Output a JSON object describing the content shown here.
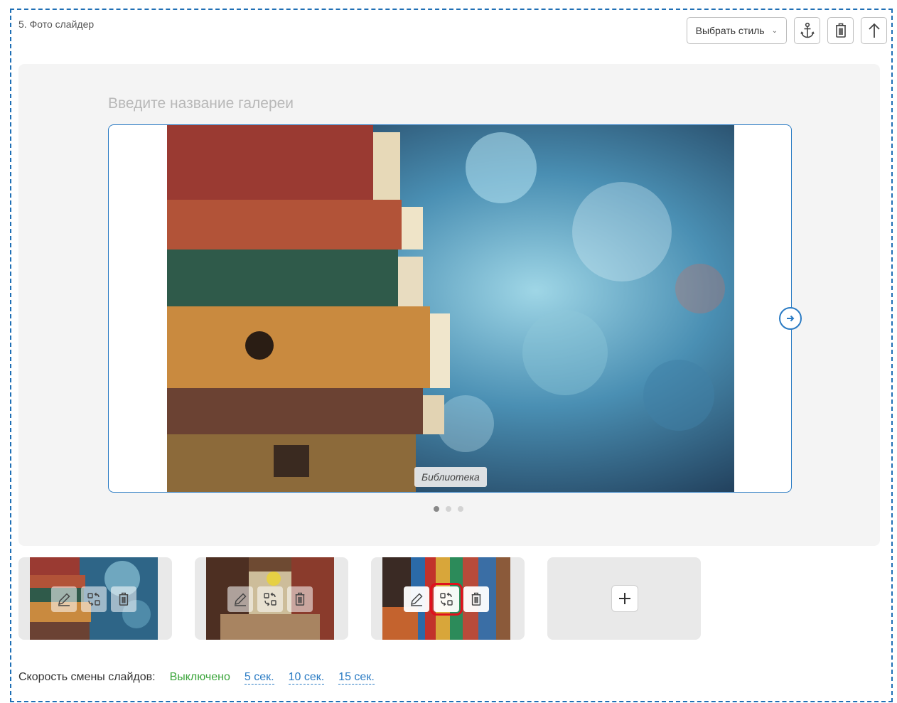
{
  "block": {
    "title": "5. Фото слайдер",
    "style_button": {
      "label": "Выбрать стиль",
      "chevron": "chevron-down-icon"
    },
    "tools": [
      {
        "name": "anchor-icon"
      },
      {
        "name": "trash-icon"
      },
      {
        "name": "arrow-up-icon"
      }
    ]
  },
  "gallery": {
    "title_placeholder": "Введите название галереи",
    "slide_caption": "Библиотека",
    "slide_count": 3,
    "active_slide": 1
  },
  "thumbnails": [
    {
      "subject": "stack of old books, bokeh background",
      "actions": [
        "pencil-icon",
        "swap-icon",
        "trash-icon"
      ]
    },
    {
      "subject": "library reading area",
      "actions": [
        "pencil-icon",
        "swap-icon",
        "trash-icon"
      ]
    },
    {
      "subject": "curved library bookshelves",
      "actions": [
        "pencil-icon",
        "swap-icon",
        "trash-icon"
      ],
      "highlighted_action": "swap-icon"
    }
  ],
  "add_button": {
    "icon": "plus-icon"
  },
  "speed": {
    "label": "Скорость смены слайдов:",
    "options": [
      {
        "label": "Выключено",
        "active": true
      },
      {
        "label": "5 сек.",
        "active": false
      },
      {
        "label": "10 сек.",
        "active": false
      },
      {
        "label": "15 сек.",
        "active": false
      }
    ]
  },
  "colors": {
    "accent": "#2a7bc4",
    "active_option": "#3ba53b",
    "highlight": "#e0101c"
  }
}
